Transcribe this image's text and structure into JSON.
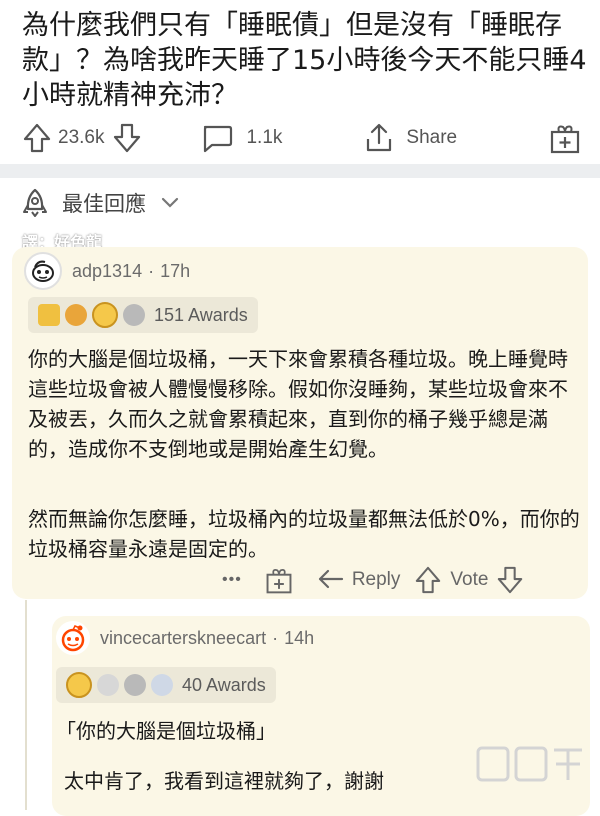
{
  "post": {
    "title": "為什麼我們只有「睡眠債」但是沒有「睡眠存款」？為啥我昨天睡了15小時後今天不能只睡4小時就精神充沛？",
    "upvotes": "23.6k",
    "comments": "1.1k",
    "share_label": "Share"
  },
  "sort": {
    "label": "最佳回應"
  },
  "translator": "譯：好色龍",
  "comments": [
    {
      "author": "adp1314",
      "age": "17h",
      "awards": "151 Awards",
      "paragraphs": [
        "你的大腦是個垃圾桶，一天下來會累積各種垃圾。晚上睡覺時這些垃圾會被人體慢慢移除。假如你沒睡夠，某些垃圾會來不及被丟，久而久之就會累積起來，直到你的桶子幾乎總是滿的，造成你不支倒地或是開始產生幻覺。",
        "然而無論你怎麼睡，垃圾桶內的垃圾量都無法低於0%，而你的垃圾桶容量永遠是固定的。"
      ],
      "more": "•••",
      "reply_label": "Reply",
      "vote_label": "Vote"
    },
    {
      "author": "vincecarterskneecart",
      "age": "14h",
      "awards": "40 Awards",
      "paragraphs": [
        "「你的大腦是個垃圾桶」",
        "太中肯了，我看到這裡就夠了，謝謝"
      ]
    }
  ],
  "colors": {
    "card_bg": "#fbf7e6",
    "divider": "#eceef0"
  }
}
